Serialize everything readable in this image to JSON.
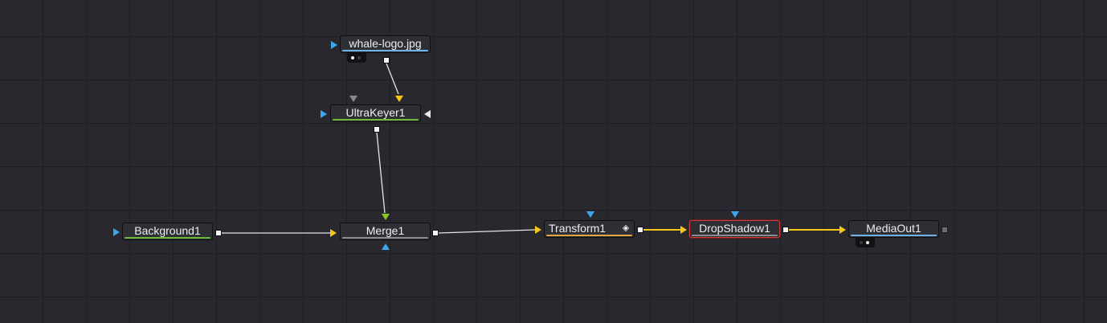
{
  "colors": {
    "background": "#28282e",
    "grid": "#1e1e23",
    "wire_default": "#e6e6e6",
    "wire_active": "#f5c518",
    "input_blue": "#3aa8ef",
    "input_yellow": "#f5c518",
    "input_green": "#8bc724",
    "input_grey": "#8a8a8e",
    "input_white": "#e8e8e8",
    "bar_blue": "#6fb2ea",
    "bar_green": "#6fb83a",
    "bar_orange": "#e8a246",
    "bar_grey": "#8c8c90",
    "selected_border": "#d23a36"
  },
  "nodes": {
    "whale_logo": {
      "label": "whale-logo.jpg",
      "bar_color": "#6fb2ea",
      "icon": "view-indicator-icon"
    },
    "ultrakeyer": {
      "label": "UltraKeyer1",
      "bar_color": "#6fb83a"
    },
    "background": {
      "label": "Background1",
      "bar_color": "#6fb83a"
    },
    "merge": {
      "label": "Merge1",
      "bar_color": "#8c8c90"
    },
    "transform": {
      "label": "Transform1",
      "bar_color": "#e8a246",
      "icon": "keyframe-icon"
    },
    "dropshadow": {
      "label": "DropShadow1",
      "bar_color": "#8c8c90",
      "selected": true
    },
    "mediaout": {
      "label": "MediaOut1",
      "bar_color": "#6fb2ea",
      "icon": "view-indicator-icon"
    }
  },
  "connections": [
    {
      "from": "whale-logo.jpg",
      "to": "UltraKeyer1",
      "input": "foreground",
      "color": "#e6e6e6"
    },
    {
      "from": "UltraKeyer1",
      "to": "Merge1",
      "input": "foreground",
      "color": "#e6e6e6"
    },
    {
      "from": "Background1",
      "to": "Merge1",
      "input": "background",
      "color": "#e6e6e6"
    },
    {
      "from": "Merge1",
      "to": "Transform1",
      "input": "background",
      "color": "#e6e6e6"
    },
    {
      "from": "Transform1",
      "to": "DropShadow1",
      "input": "background",
      "color": "#f5c518"
    },
    {
      "from": "DropShadow1",
      "to": "MediaOut1",
      "input": "background",
      "color": "#f5c518"
    }
  ]
}
